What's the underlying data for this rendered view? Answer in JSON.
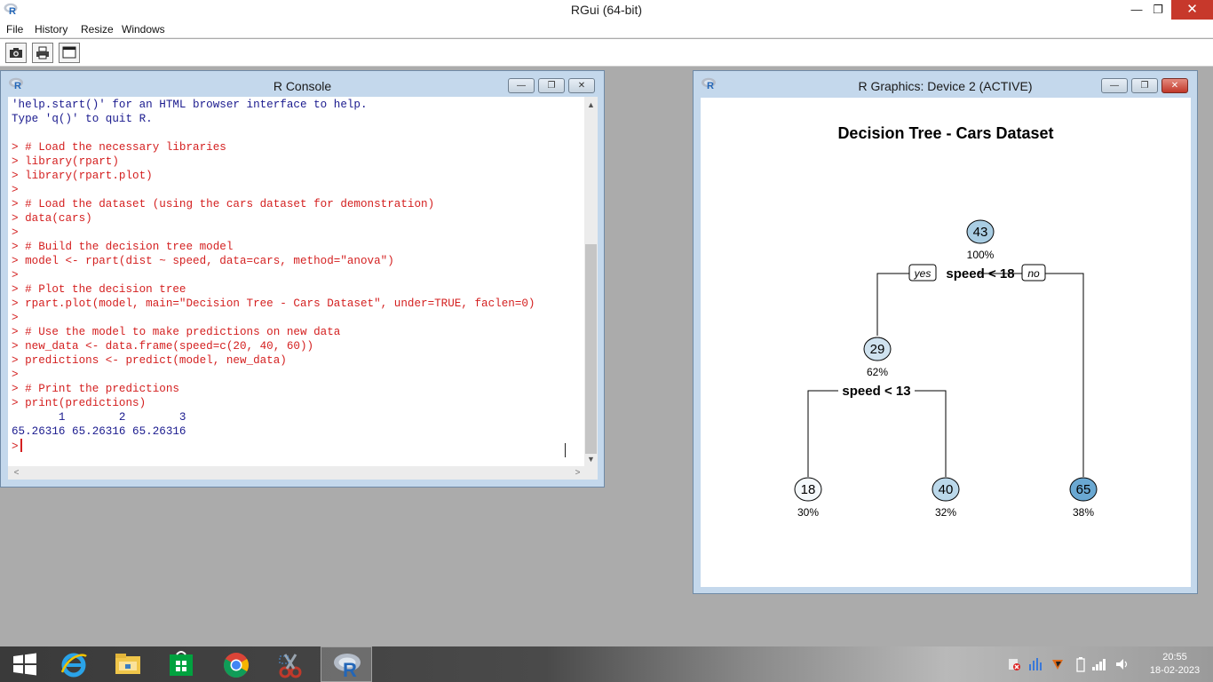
{
  "app": {
    "title": "RGui (64-bit)"
  },
  "menu": [
    "File",
    "History",
    "Resize",
    "Windows"
  ],
  "toolbar": [
    "open-script-icon",
    "print-icon",
    "console-window-icon"
  ],
  "console": {
    "title": "R Console",
    "lines": [
      {
        "t": "out",
        "text": "'help.start()' for an HTML browser interface to help."
      },
      {
        "t": "out",
        "text": "Type 'q()' to quit R."
      },
      {
        "t": "out",
        "text": ""
      },
      {
        "t": "cmd",
        "text": "> # Load the necessary libraries"
      },
      {
        "t": "cmd",
        "text": "> library(rpart)"
      },
      {
        "t": "cmd",
        "text": "> library(rpart.plot)"
      },
      {
        "t": "cmd",
        "text": ">"
      },
      {
        "t": "cmd",
        "text": "> # Load the dataset (using the cars dataset for demonstration)"
      },
      {
        "t": "cmd",
        "text": "> data(cars)"
      },
      {
        "t": "cmd",
        "text": ">"
      },
      {
        "t": "cmd",
        "text": "> # Build the decision tree model"
      },
      {
        "t": "cmd",
        "text": "> model <- rpart(dist ~ speed, data=cars, method=\"anova\")"
      },
      {
        "t": "cmd",
        "text": ">"
      },
      {
        "t": "cmd",
        "text": "> # Plot the decision tree"
      },
      {
        "t": "cmd",
        "text": "> rpart.plot(model, main=\"Decision Tree - Cars Dataset\", under=TRUE, faclen=0)"
      },
      {
        "t": "cmd",
        "text": ">"
      },
      {
        "t": "cmd",
        "text": "> # Use the model to make predictions on new data"
      },
      {
        "t": "cmd",
        "text": "> new_data <- data.frame(speed=c(20, 40, 60))"
      },
      {
        "t": "cmd",
        "text": "> predictions <- predict(model, new_data)"
      },
      {
        "t": "cmd",
        "text": ">"
      },
      {
        "t": "cmd",
        "text": "> # Print the predictions"
      },
      {
        "t": "cmd",
        "text": "> print(predictions)"
      },
      {
        "t": "out",
        "text": "       1        2        3 "
      },
      {
        "t": "out",
        "text": "65.26316 65.26316 65.26316 "
      }
    ],
    "prompt": ">"
  },
  "graphics": {
    "title": "R Graphics: Device 2 (ACTIVE)",
    "plot_title": "Decision Tree - Cars Dataset",
    "split1": "speed < 18",
    "split2": "speed < 13",
    "yes_label": "yes",
    "no_label": "no",
    "nodes": [
      {
        "id": "root",
        "value": "43",
        "pct": "100%",
        "color": "#a9cde3"
      },
      {
        "id": "left",
        "value": "29",
        "pct": "62%",
        "color": "#cfe2ef"
      },
      {
        "id": "leaf1",
        "value": "18",
        "pct": "30%",
        "color": "#f4f9fc"
      },
      {
        "id": "leaf2",
        "value": "40",
        "pct": "32%",
        "color": "#bbd8ea"
      },
      {
        "id": "leaf3",
        "value": "65",
        "pct": "38%",
        "color": "#6aa8d2"
      }
    ]
  },
  "taskbar": {
    "apps": [
      "start-icon",
      "internet-explorer-icon",
      "file-explorer-icon",
      "store-icon",
      "chrome-icon",
      "snipping-tool-icon",
      "r-gui-icon"
    ],
    "time": "20:55",
    "date": "18-02-2023"
  }
}
